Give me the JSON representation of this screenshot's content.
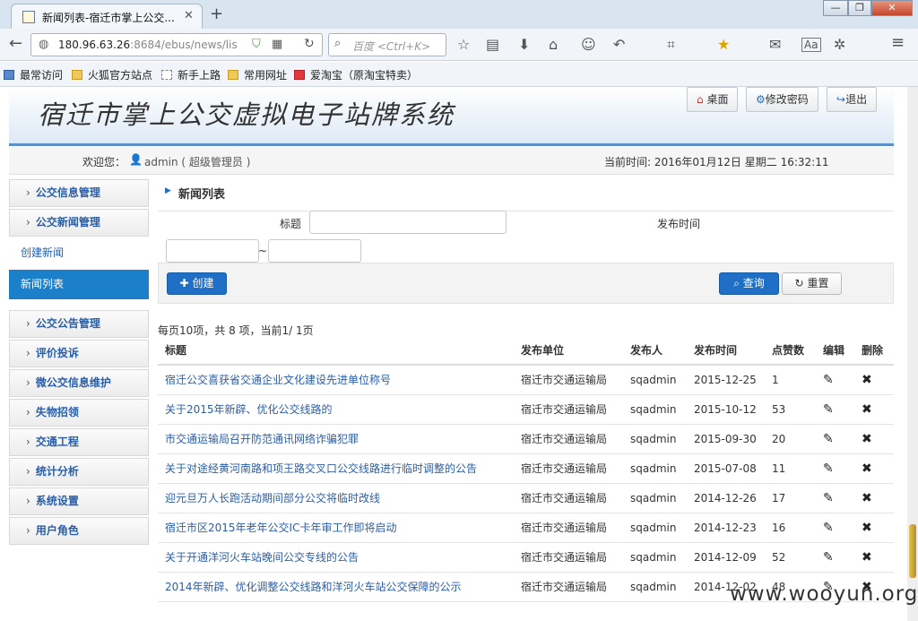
{
  "browser": {
    "tab_title": "新闻列表-宿迁市掌上公交...",
    "url_host": "180.96.63.26",
    "url_path": ":8684/ebus/news/lis",
    "search_placeholder": "百度 <Ctrl+K>",
    "bookmarks": [
      "最常访问",
      "火狐官方站点",
      "新手上路",
      "常用网址",
      "爱淘宝（原淘宝特卖）"
    ]
  },
  "header": {
    "system_title": "宿迁市掌上公交虚拟电子站牌系统",
    "desktop_label": "桌面",
    "change_password_label": "修改密码",
    "logout_label": "退出"
  },
  "welcome": {
    "prefix": "欢迎您：",
    "user": "admin ( 超级管理员 )",
    "time": "当前时间: 2016年01月12日  星期二 16:32:11"
  },
  "sidebar": {
    "items": [
      "公交信息管理",
      "公交新闻管理"
    ],
    "sub_items": [
      "创建新闻",
      "新闻列表"
    ],
    "items_after": [
      "公交公告管理",
      "评价投诉",
      "微公交信息维护",
      "失物招领",
      "交通工程",
      "统计分析",
      "系统设置",
      "用户角色"
    ]
  },
  "main": {
    "section_title": "新闻列表",
    "title_label": "标题",
    "publish_time_label": "发布时间",
    "range_sep": "~",
    "create_label": "创建",
    "query_label": "查询",
    "reset_label": "重置",
    "pagination": "每页10项，共 8 项，当前1/ 1页",
    "columns": [
      "标题",
      "发布单位",
      "发布人",
      "发布时间",
      "点赞数",
      "编辑",
      "删除"
    ],
    "rows": [
      {
        "title": "宿迁公交喜获省交通企业文化建设先进单位称号",
        "unit": "宿迁市交通运输局",
        "author": "sqadmin",
        "date": "2015-12-25",
        "likes": "1"
      },
      {
        "title": "关于2015年新辟、优化公交线路的",
        "unit": "宿迁市交通运输局",
        "author": "sqadmin",
        "date": "2015-10-12",
        "likes": "53"
      },
      {
        "title": "市交通运输局召开防范通讯网络诈骗犯罪",
        "unit": "宿迁市交通运输局",
        "author": "sqadmin",
        "date": "2015-09-30",
        "likes": "20"
      },
      {
        "title": "关于对途经黄河南路和项王路交叉口公交线路进行临时调整的公告",
        "unit": "宿迁市交通运输局",
        "author": "sqadmin",
        "date": "2015-07-08",
        "likes": "11"
      },
      {
        "title": "迎元旦万人长跑活动期间部分公交将临时改线",
        "unit": "宿迁市交通运输局",
        "author": "sqadmin",
        "date": "2014-12-26",
        "likes": "17"
      },
      {
        "title": "宿迁市区2015年老年公交IC卡年审工作即将启动",
        "unit": "宿迁市交通运输局",
        "author": "sqadmin",
        "date": "2014-12-23",
        "likes": "16"
      },
      {
        "title": "关于开通洋河火车站晚间公交专线的公告",
        "unit": "宿迁市交通运输局",
        "author": "sqadmin",
        "date": "2014-12-09",
        "likes": "52"
      },
      {
        "title": "2014年新辟、优化调整公交线路和洋河火车站公交保障的公示",
        "unit": "宿迁市交通运输局",
        "author": "sqadmin",
        "date": "2014-12-02",
        "likes": "48"
      }
    ]
  },
  "watermark": "www.wooyun.org"
}
